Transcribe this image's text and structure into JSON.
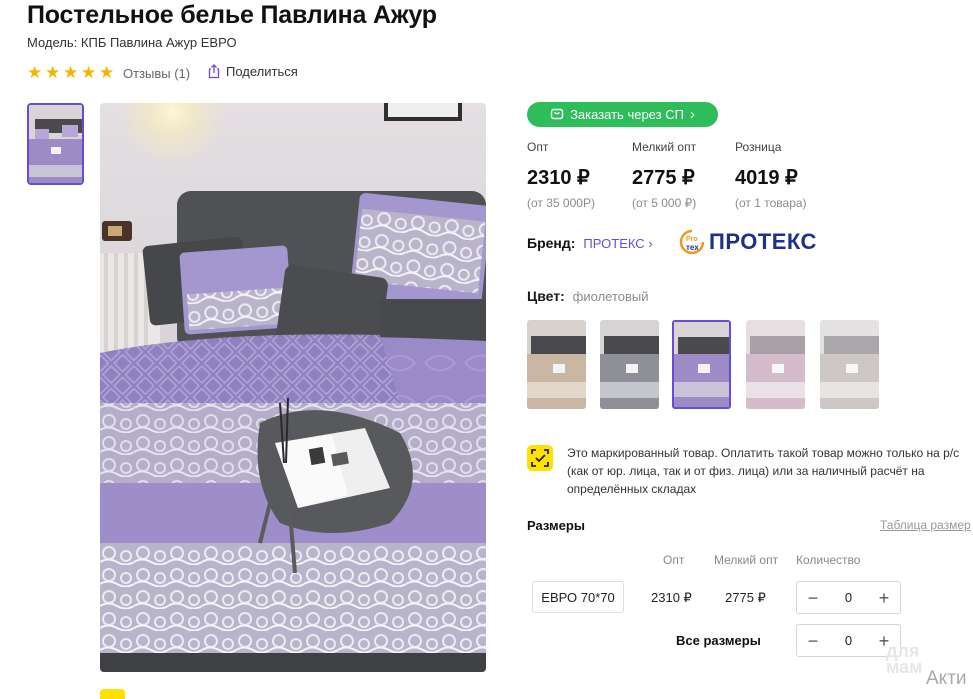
{
  "product": {
    "title": "Постельное белье Павлина Ажур",
    "model_label": "Модель:",
    "model_value": "КПБ Павлина Ажур ЕВРО",
    "stars": 5,
    "reviews_label": "Отзывы (1)",
    "share_label": "Поделиться"
  },
  "purchase": {
    "sp_button_label": "Заказать через СП",
    "prices": [
      {
        "label": "Опт",
        "value": "2310 ₽",
        "note": "(от 35 000Р)"
      },
      {
        "label": "Мелкий опт",
        "value": "2775 ₽",
        "note": "(от 5 000 ₽)"
      },
      {
        "label": "Розница",
        "value": "4019 ₽",
        "note": "(от 1 товара)"
      }
    ]
  },
  "brand": {
    "label": "Бренд:",
    "name": "ПРОТЕКС",
    "logo_text": "ПРОТЕКС",
    "logo_badge": "Pro тех"
  },
  "color": {
    "label": "Цвет:",
    "value": "фиолетовый",
    "swatches": [
      "beige",
      "grey",
      "purple",
      "pink",
      "light-grey"
    ],
    "selected_index": 2
  },
  "marking": {
    "text": "Это маркированный товар. Оплатить такой товар можно только на р/с (как от юр. лица, так и от физ. лица) или за наличный расчёт на определённых складах"
  },
  "sizes": {
    "heading": "Размеры",
    "table_link": "Таблица размер",
    "columns": [
      "Опт",
      "Мелкий опт",
      "Количество"
    ],
    "rows": [
      {
        "size": "ЕВРО 70*70",
        "opt": "2310 ₽",
        "small_opt": "2775 ₽",
        "qty": "0"
      }
    ],
    "all_sizes_label": "Все размеры",
    "all_sizes_qty": "0"
  },
  "watermark": {
    "line1": "для",
    "line2": "мам",
    "activate": "Акти"
  },
  "colors": {
    "accent": "#6b4bd6",
    "green": "#2ebd5b",
    "star": "#f5b400",
    "yellow": "#ffe100",
    "brand_blue": "#1e2f8f"
  }
}
